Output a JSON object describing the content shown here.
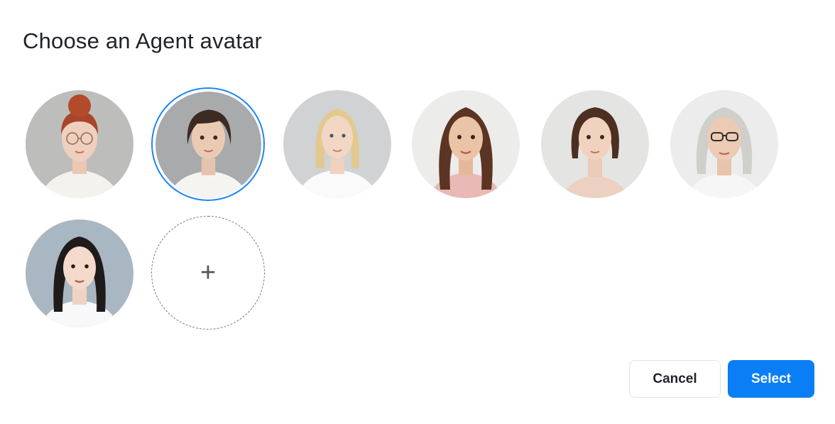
{
  "dialog": {
    "title": "Choose an Agent avatar"
  },
  "avatars": [
    {
      "id": "avatar-1",
      "description_icon": "portrait-red-hair-glasses",
      "selected": false
    },
    {
      "id": "avatar-2",
      "description_icon": "portrait-brown-short-hair",
      "selected": true
    },
    {
      "id": "avatar-3",
      "description_icon": "portrait-blonde-hair",
      "selected": false
    },
    {
      "id": "avatar-4",
      "description_icon": "portrait-long-brown-hair",
      "selected": false
    },
    {
      "id": "avatar-5",
      "description_icon": "portrait-bob-brown-hair",
      "selected": false
    },
    {
      "id": "avatar-6",
      "description_icon": "portrait-gray-hair-glasses",
      "selected": false
    },
    {
      "id": "avatar-7",
      "description_icon": "portrait-black-long-hair",
      "selected": false
    }
  ],
  "add_avatar": {
    "icon": "plus-icon",
    "glyph": "+"
  },
  "actions": {
    "cancel_label": "Cancel",
    "select_label": "Select"
  },
  "colors": {
    "accent": "#0a7ef5",
    "selected_ring": "#1b88f5"
  }
}
